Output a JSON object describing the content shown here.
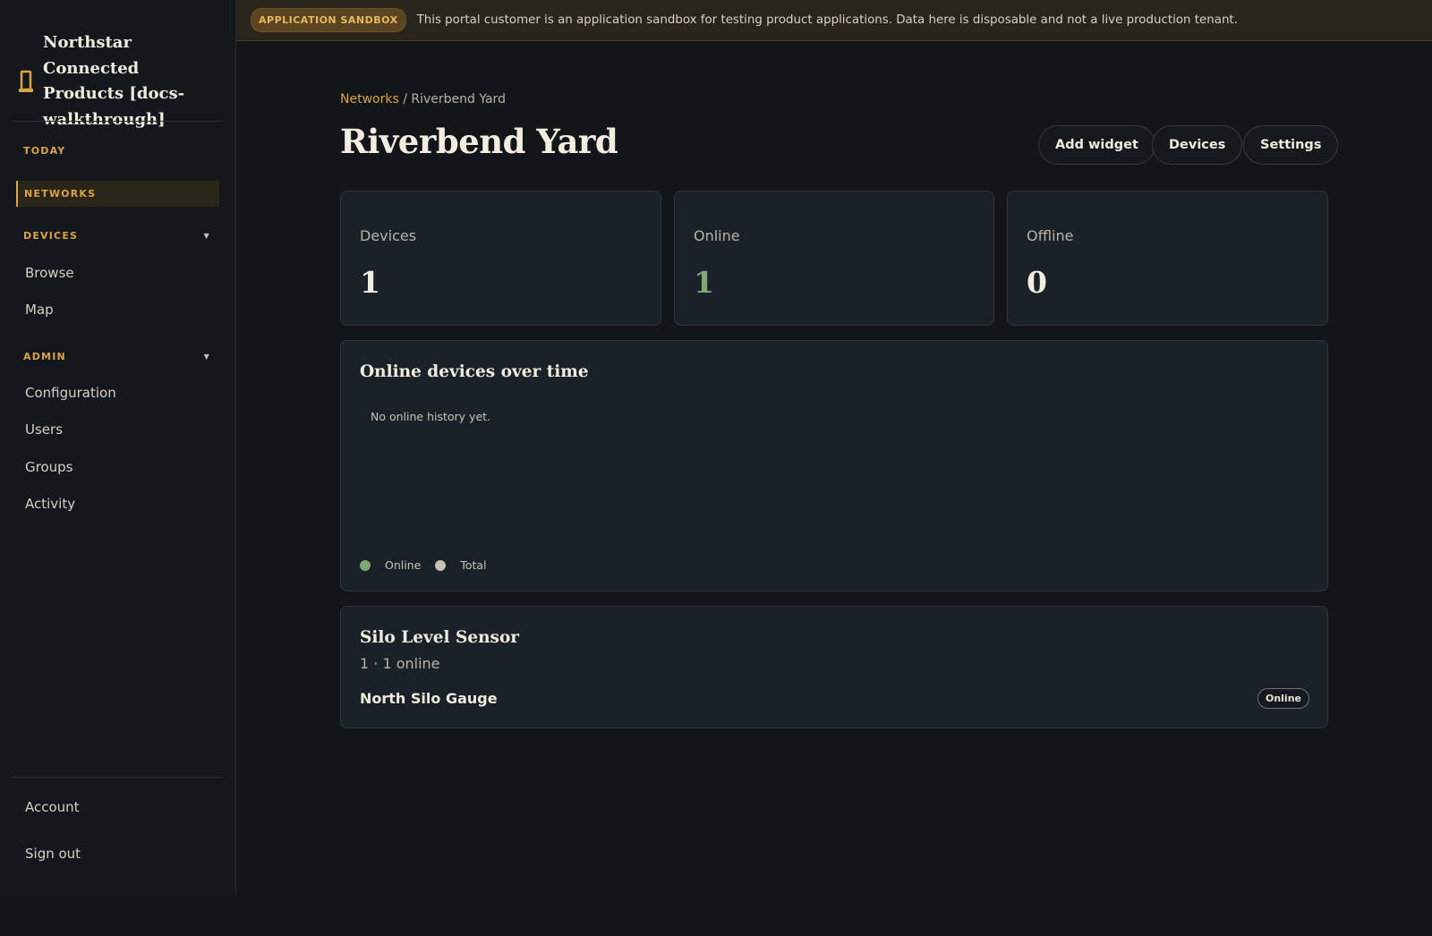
{
  "brand": {
    "icon": "lamp-post-icon",
    "name": "Northstar Connected Products [docs-walkthrough]",
    "accent": "#d9a441"
  },
  "sidebar": {
    "today": "TODAY",
    "networks": "NETWORKS",
    "devices_section": "DEVICES",
    "devices_items": [
      "Browse",
      "Map"
    ],
    "admin_section": "ADMIN",
    "admin_items": [
      "Configuration",
      "Users",
      "Groups",
      "Activity"
    ],
    "account": "Account",
    "sign_out": "Sign out"
  },
  "banner": {
    "badge": "APPLICATION SANDBOX",
    "text": "This portal customer is an application sandbox for testing product applications. Data here is disposable and not a live production tenant."
  },
  "breadcrumb": {
    "parent": "Networks",
    "separator": " / ",
    "current": "Riverbend Yard"
  },
  "page": {
    "title": "Riverbend Yard",
    "buttons": [
      "Add widget",
      "Devices",
      "Settings"
    ]
  },
  "stats": [
    {
      "label": "Devices",
      "value": "1"
    },
    {
      "label": "Online",
      "value": "1"
    },
    {
      "label": "Offline",
      "value": "0"
    }
  ],
  "online_chart": {
    "title": "Online devices over time",
    "empty_message": "No online history yet.",
    "legend": [
      {
        "label": "Online",
        "color": "#7fa872"
      },
      {
        "label": "Total",
        "color": "#c9c2b2"
      }
    ]
  },
  "group": {
    "title": "Silo Level Sensor",
    "subtitle": "1 · 1 online",
    "device_name": "North Silo Gauge",
    "status": "Online"
  }
}
